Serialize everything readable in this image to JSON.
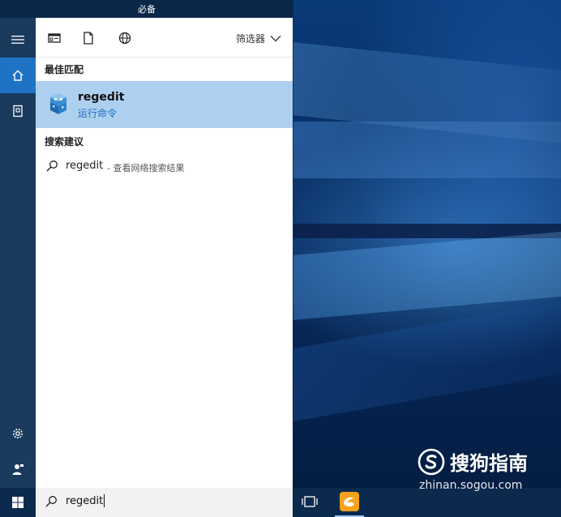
{
  "top_strip": {
    "title": "必备"
  },
  "rail": {
    "items": [
      {
        "icon": "hamburger-menu-icon"
      },
      {
        "icon": "home-icon"
      },
      {
        "icon": "notebook-icon"
      },
      {
        "icon": "settings-gear-icon"
      },
      {
        "icon": "feedback-person-icon"
      }
    ]
  },
  "panel": {
    "toolbar": {
      "icons": [
        "apps-icon",
        "documents-icon",
        "web-icon"
      ],
      "filter_label": "筛选器"
    },
    "best_match": {
      "heading": "最佳匹配",
      "title": "regedit",
      "subtitle": "运行命令"
    },
    "suggestions": {
      "heading": "搜索建议",
      "items": [
        {
          "term": "regedit",
          "description": "- 查看网络搜索结果"
        }
      ]
    }
  },
  "taskbar": {
    "search_value": "regedit",
    "icons": [
      "windows-start-icon",
      "task-view-icon",
      "uc-browser-icon"
    ]
  },
  "watermark": {
    "brand": "搜狗指南",
    "url": "zhinan.sogou.com"
  },
  "colors": {
    "accent": "#1f73c4",
    "selection": "#aed0ef",
    "rail": "#1a3a5e",
    "taskbar": "#0b2a4e",
    "link": "#1a6fc0"
  }
}
